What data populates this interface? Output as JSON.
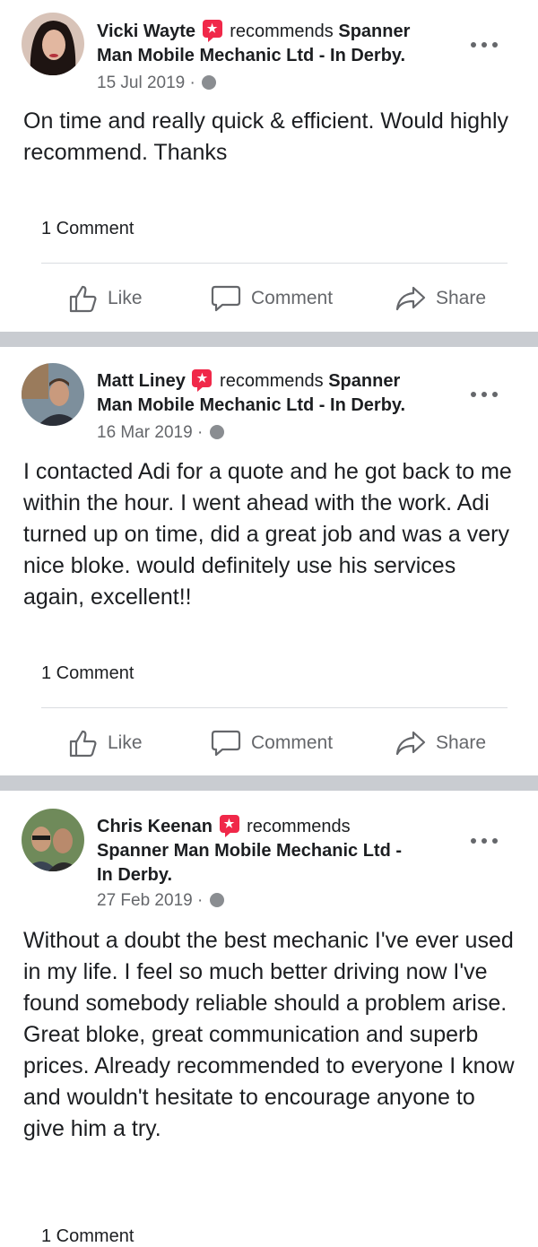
{
  "posts": [
    {
      "author": "Vicki Wayte",
      "recommends": "recommends",
      "business_line1": "Spanner",
      "business_line2": "Man Mobile Mechanic Ltd - In Derby.",
      "date": "15 Jul 2019 ·",
      "body": "On time and really quick & efficient.  Would highly recommend. Thanks",
      "comments": "1 Comment",
      "like": "Like",
      "comment": "Comment",
      "share": "Share"
    },
    {
      "author": "Matt Liney",
      "recommends": "recommends",
      "business_line1": "Spanner",
      "business_line2": "Man Mobile Mechanic Ltd - In Derby.",
      "date": "16 Mar 2019 ·",
      "body": "I contacted Adi for a quote and he got back to me within the hour. I went ahead with the work. Adi turned up on time, did a great job and was a very nice bloke. would definitely use his services again, excellent!!",
      "comments": "1 Comment",
      "like": "Like",
      "comment": "Comment",
      "share": "Share"
    },
    {
      "author": "Chris Keenan",
      "recommends": "recommends",
      "business_line1": "Spanner Man Mobile Mechanic Ltd -",
      "business_line2": "In Derby.",
      "date": "27 Feb 2019 ·",
      "body": "Without a doubt the best mechanic I've ever used in my life. I feel so much better driving now I've found somebody reliable should a problem arise. Great bloke, great communication and superb prices. Already recommended to everyone I know and wouldn't hesitate to encourage anyone to give him a try.",
      "comments": "1 Comment"
    }
  ],
  "icons": {
    "like": "thumbs-up-icon",
    "comment": "speech-bubble-icon",
    "share": "share-arrow-icon",
    "more": "more-options-icon",
    "audience": "globe-icon",
    "badge": "recommendation-badge-icon"
  },
  "colors": {
    "text": "#1c1e21",
    "secondary": "#65676b",
    "badge": "#f02849",
    "separator": "#c9ccd1"
  }
}
